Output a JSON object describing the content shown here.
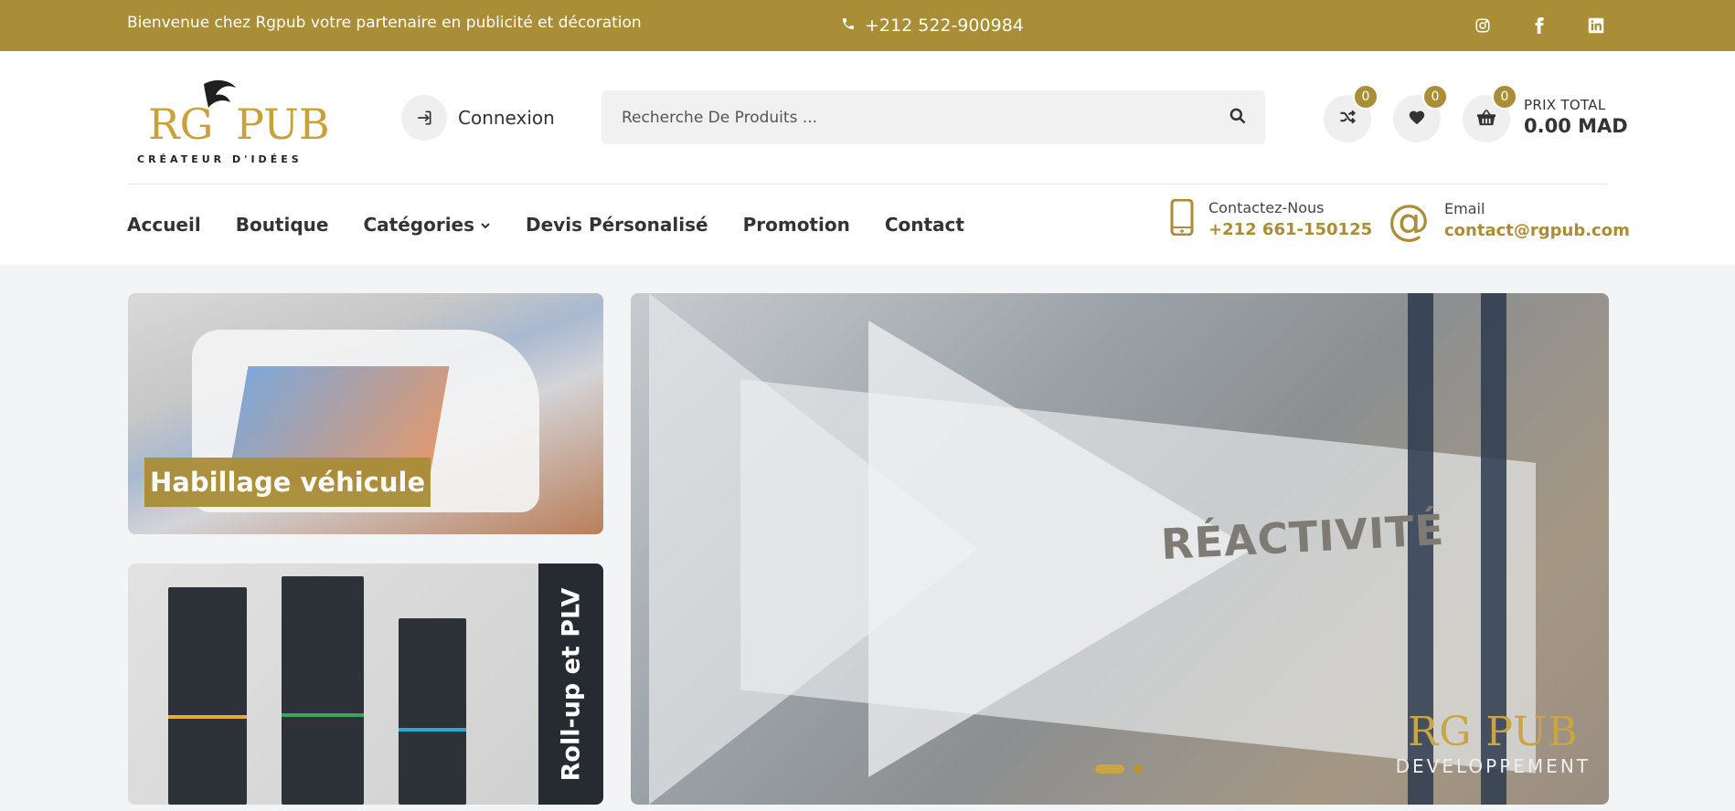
{
  "topbar": {
    "welcome": "Bienvenue chez Rgpub votre partenaire en publicité et décoration",
    "phone": "+212 522-900984",
    "social": [
      "instagram-icon",
      "facebook-icon",
      "linkedin-icon"
    ]
  },
  "header": {
    "logo": {
      "main": "RG PUB",
      "tagline": "CRÉATEUR D'IDÉES"
    },
    "login_label": "Connexion",
    "search_placeholder": "Recherche De Produits ...",
    "counters": {
      "compare": "0",
      "wishlist": "0",
      "cart": "0"
    },
    "total_label": "PRIX TOTAL",
    "total_value": "0.00 MAD"
  },
  "nav": {
    "items": [
      "Accueil",
      "Boutique",
      "Catégories",
      "Devis Pérsonalisé",
      "Promotion",
      "Contact"
    ]
  },
  "contact": {
    "phone_label": "Contactez-Nous",
    "phone_value": "+212 661-150125",
    "email_label": "Email",
    "email_value": "contact@rgpub.com"
  },
  "banners": {
    "vehicle": "Habillage véhicule",
    "rollup": "Roll-up et PLV"
  },
  "hero": {
    "glass_text": "RÉACTIVITÉ",
    "logo_main": "RG PUB",
    "logo_sub": "DEVELOPPEMENT",
    "slides_total": 2,
    "slide_active": 1
  },
  "colors": {
    "accent": "#a98d37",
    "dark": "#262b32"
  }
}
